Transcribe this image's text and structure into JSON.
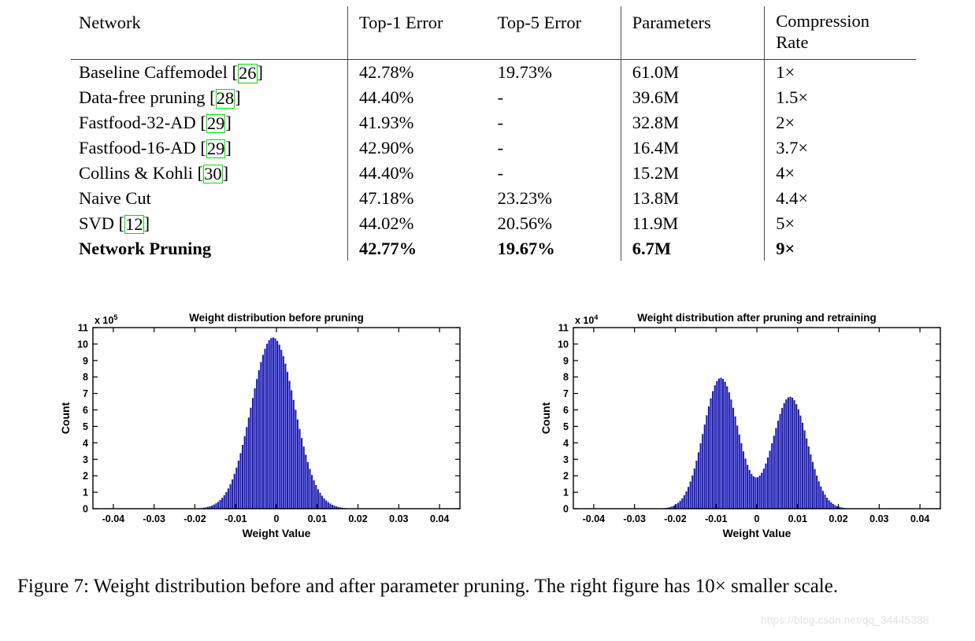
{
  "table": {
    "headers": [
      "Network",
      "Top-1 Error",
      "Top-5 Error",
      "Parameters",
      "Compression Rate"
    ],
    "header_compression_line1": "Compression",
    "header_compression_line2": "Rate",
    "rows": [
      {
        "network": "Baseline Caffemodel",
        "cite": "26",
        "top1": "42.78%",
        "top5": "19.73%",
        "params": "61.0M",
        "compression": "1×",
        "bold": false
      },
      {
        "network": "Data-free pruning",
        "cite": "28",
        "top1": "44.40%",
        "top5": "-",
        "params": "39.6M",
        "compression": "1.5×",
        "bold": false
      },
      {
        "network": "Fastfood-32-AD",
        "cite": "29",
        "top1": "41.93%",
        "top5": "-",
        "params": "32.8M",
        "compression": "2×",
        "bold": false
      },
      {
        "network": "Fastfood-16-AD",
        "cite": "29",
        "top1": "42.90%",
        "top5": "-",
        "params": "16.4M",
        "compression": "3.7×",
        "bold": false
      },
      {
        "network": "Collins & Kohli",
        "cite": "30",
        "top1": "44.40%",
        "top5": "-",
        "params": "15.2M",
        "compression": "4×",
        "bold": false
      },
      {
        "network": "Naive Cut",
        "cite": "",
        "top1": "47.18%",
        "top5": "23.23%",
        "params": "13.8M",
        "compression": "4.4×",
        "bold": false
      },
      {
        "network": "SVD",
        "cite": "12",
        "top1": "44.02%",
        "top5": "20.56%",
        "params": "11.9M",
        "compression": "5×",
        "bold": false
      },
      {
        "network": "Network Pruning",
        "cite": "",
        "top1": "42.77%",
        "top5": "19.67%",
        "params": "6.7M",
        "compression": "9×",
        "bold": true
      }
    ]
  },
  "caption": {
    "text": "Figure 7: Weight distribution before and after parameter pruning. The right figure has 10× smaller scale."
  },
  "watermark": {
    "text": "https://blog.csdn.net/qq_34445388"
  },
  "chart_data": [
    {
      "id": "before",
      "type": "bar",
      "title": "Weight distribution before pruning",
      "xlabel": "Weight Value",
      "ylabel": "Count",
      "y_multiplier": "x 10",
      "y_multiplier_exp": "5",
      "xlim": [
        -0.045,
        0.045
      ],
      "ylim": [
        0,
        11
      ],
      "xticks": [
        -0.04,
        -0.03,
        -0.02,
        -0.01,
        0,
        0.01,
        0.02,
        0.03,
        0.04
      ],
      "xtick_labels": [
        "-0.04",
        "-0.03",
        "-0.02",
        "-0.01",
        "0",
        "0.01",
        "0.02",
        "0.03",
        "0.04"
      ],
      "yticks": [
        0,
        1,
        2,
        3,
        4,
        5,
        6,
        7,
        8,
        9,
        10,
        11
      ],
      "ytick_labels": [
        "0",
        "1",
        "2",
        "3",
        "4",
        "5",
        "6",
        "7",
        "8",
        "9",
        "10",
        "11"
      ],
      "grid": false,
      "bar_color": "#1d1db4",
      "peak_value": 10.4,
      "peak_x": -0.0008,
      "distribution": "unimodal-gaussian",
      "sigma": 0.0053,
      "bin_count": 180,
      "bin_width": 0.0005,
      "description": "Single sharp peak centered near zero reaching 1.04e6 counts; tails fade out by +/-0.02."
    },
    {
      "id": "after",
      "type": "bar",
      "title": "Weight distribution after pruning and retraining",
      "xlabel": "Weight Value",
      "ylabel": "Count",
      "y_multiplier": "x 10",
      "y_multiplier_exp": "4",
      "xlim": [
        -0.045,
        0.045
      ],
      "ylim": [
        0,
        11
      ],
      "xticks": [
        -0.04,
        -0.03,
        -0.02,
        -0.01,
        0,
        0.01,
        0.02,
        0.03,
        0.04
      ],
      "xtick_labels": [
        "-0.04",
        "-0.03",
        "-0.02",
        "-0.01",
        "0",
        "0.01",
        "0.02",
        "0.03",
        "0.04"
      ],
      "yticks": [
        0,
        1,
        2,
        3,
        4,
        5,
        6,
        7,
        8,
        9,
        10,
        11
      ],
      "ytick_labels": [
        "0",
        "1",
        "2",
        "3",
        "4",
        "5",
        "6",
        "7",
        "8",
        "9",
        "10",
        "11"
      ],
      "grid": false,
      "bar_color": "#1d1db4",
      "distribution": "bimodal-gaussian",
      "modes": [
        {
          "center": -0.0088,
          "amplitude": 7.95,
          "sigma": 0.0042
        },
        {
          "center": 0.0082,
          "amplitude": 6.8,
          "sigma": 0.0042
        }
      ],
      "valley_value": 2.8,
      "valley_x": -0.0012,
      "bin_count": 180,
      "bin_width": 0.0005,
      "description": "Two symmetric lobes; left peak 7.95e4 at -0.0088, right peak 6.8e4 at 0.0082, valley 2.8e4 near zero."
    }
  ]
}
